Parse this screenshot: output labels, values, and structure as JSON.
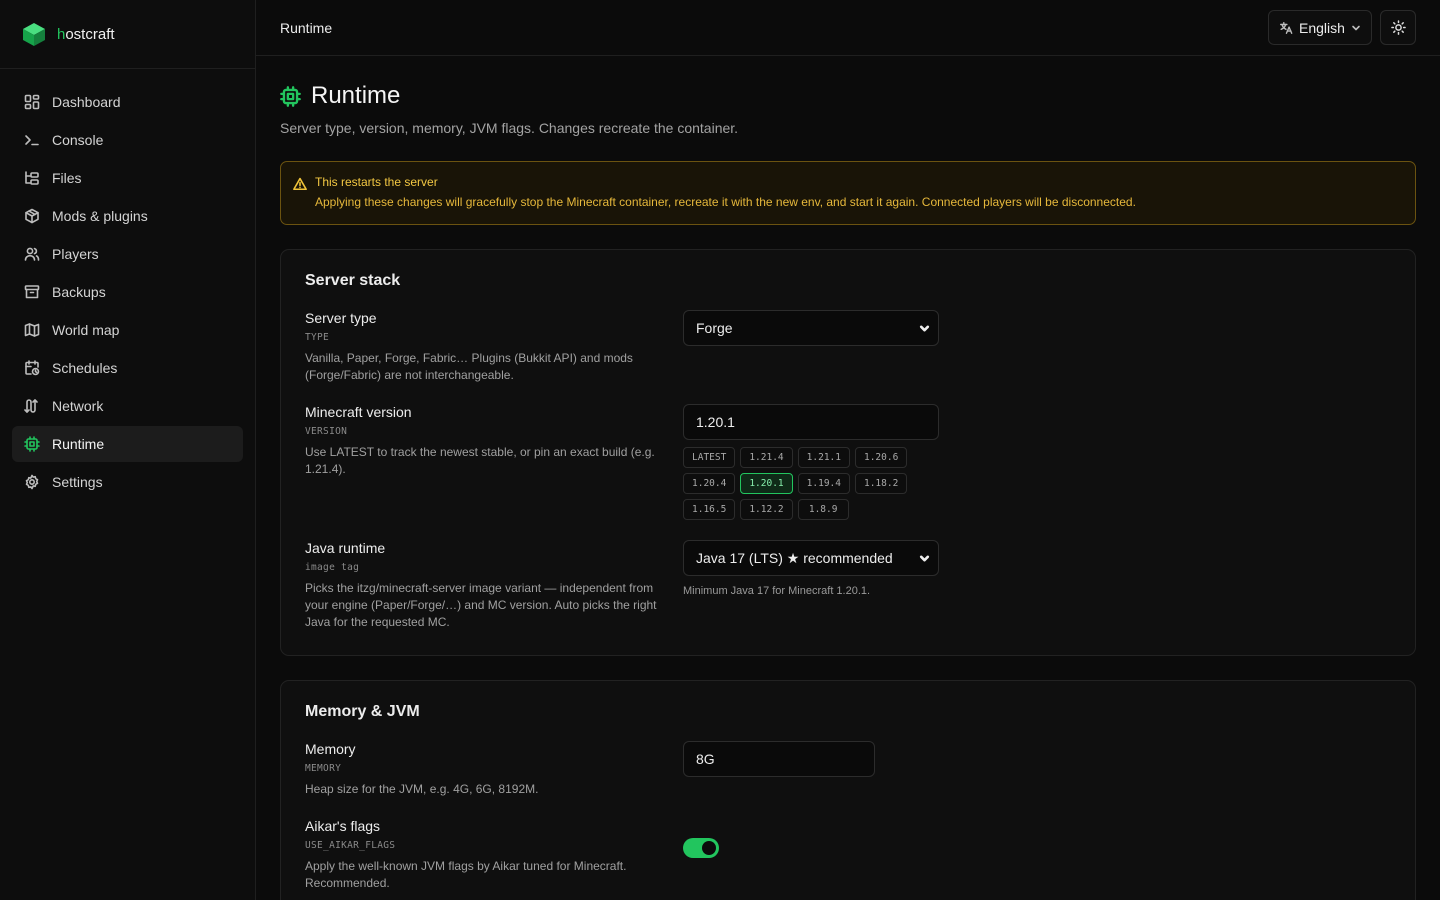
{
  "brand": {
    "first_letter": "h",
    "rest": "ostcraft"
  },
  "sidebar": {
    "items": [
      {
        "label": "Dashboard",
        "icon": "dashboard-icon"
      },
      {
        "label": "Console",
        "icon": "terminal-icon"
      },
      {
        "label": "Files",
        "icon": "files-icon"
      },
      {
        "label": "Mods & plugins",
        "icon": "package-icon"
      },
      {
        "label": "Players",
        "icon": "users-icon"
      },
      {
        "label": "Backups",
        "icon": "archive-icon"
      },
      {
        "label": "World map",
        "icon": "map-icon"
      },
      {
        "label": "Schedules",
        "icon": "calendar-clock-icon"
      },
      {
        "label": "Network",
        "icon": "network-icon"
      },
      {
        "label": "Runtime",
        "icon": "cpu-icon",
        "active": true
      },
      {
        "label": "Settings",
        "icon": "gear-icon"
      }
    ]
  },
  "topbar": {
    "title": "Runtime",
    "language": "English"
  },
  "page": {
    "title": "Runtime",
    "subtitle": "Server type, version, memory, JVM flags. Changes recreate the container."
  },
  "warning": {
    "title": "This restarts the server",
    "text": "Applying these changes will gracefully stop the Minecraft container, recreate it with the new env, and start it again. Connected players will be disconnected."
  },
  "server_stack": {
    "title": "Server stack",
    "server_type": {
      "label": "Server type",
      "key": "TYPE",
      "desc": "Vanilla, Paper, Forge, Fabric… Plugins (Bukkit API) and mods (Forge/Fabric) are not interchangeable.",
      "value": "Forge"
    },
    "version": {
      "label": "Minecraft version",
      "key": "VERSION",
      "desc": "Use LATEST to track the newest stable, or pin an exact build (e.g. 1.21.4).",
      "value": "1.20.1",
      "chips": [
        "LATEST",
        "1.21.4",
        "1.21.1",
        "1.20.6",
        "1.20.4",
        "1.20.1",
        "1.19.4",
        "1.18.2",
        "1.16.5",
        "1.12.2",
        "1.8.9"
      ],
      "selected_chip": "1.20.1"
    },
    "java": {
      "label": "Java runtime",
      "key": "image tag",
      "desc": "Picks the itzg/minecraft-server image variant — independent from your engine (Paper/Forge/…) and MC version. Auto picks the right Java for the requested MC.",
      "value": "Java 17 (LTS) ★ recommended",
      "hint": "Minimum Java 17 for Minecraft 1.20.1."
    }
  },
  "memory_jvm": {
    "title": "Memory & JVM",
    "memory": {
      "label": "Memory",
      "key": "MEMORY",
      "desc": "Heap size for the JVM, e.g. 4G, 6G, 8192M.",
      "value": "8G"
    },
    "aikar": {
      "label": "Aikar's flags",
      "key": "USE_AIKAR_FLAGS",
      "desc": "Apply the well-known JVM flags by Aikar tuned for Minecraft. Recommended.",
      "enabled": true
    }
  },
  "colors": {
    "accent": "#22c55e",
    "warning": "#f0c43a",
    "background": "#0b0b0b"
  }
}
